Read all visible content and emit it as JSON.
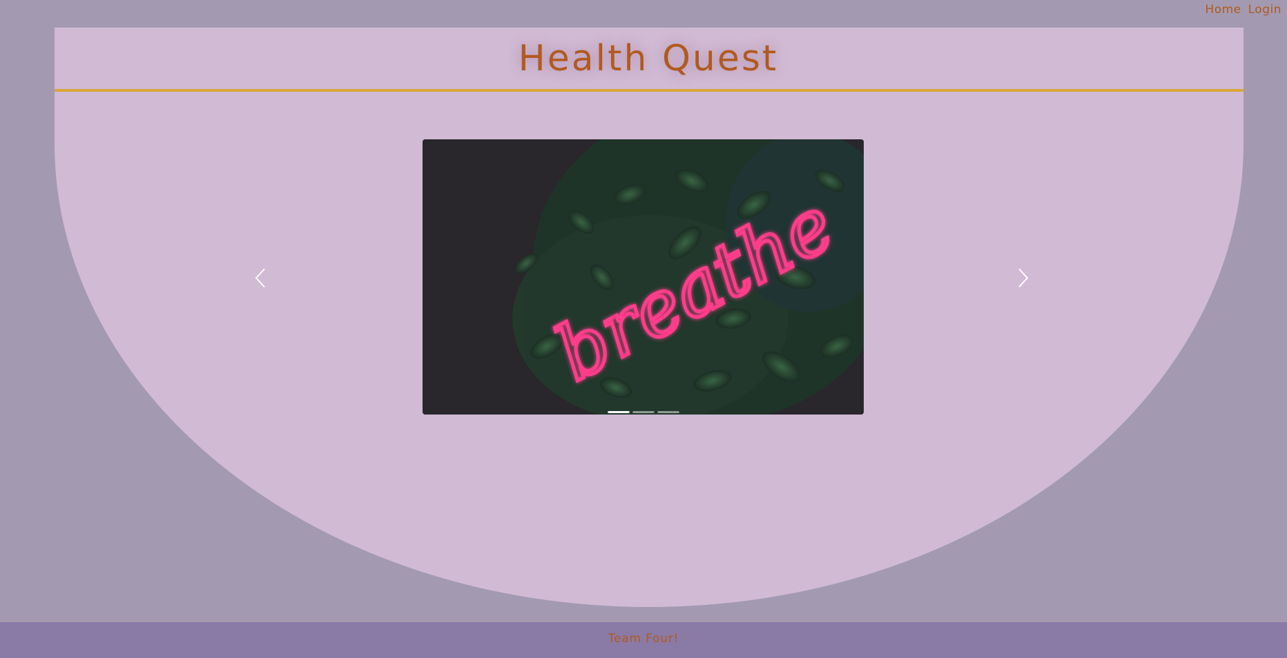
{
  "nav": {
    "home_label": "Home",
    "login_label": "Login"
  },
  "header": {
    "title": "Health Quest"
  },
  "carousel": {
    "slide_text": "breathe",
    "slide_count": 3,
    "active_slide": 1,
    "prev_icon": "chevron-left-icon",
    "next_icon": "chevron-right-icon"
  },
  "footer": {
    "text": "Team Four!"
  },
  "colors": {
    "background": "#a39ab2",
    "card": "#d1bad4",
    "accent_text": "#b15a1e",
    "divider": "#d7a73a",
    "footer": "#8a7aa6",
    "neon": "#ff3d8b"
  }
}
